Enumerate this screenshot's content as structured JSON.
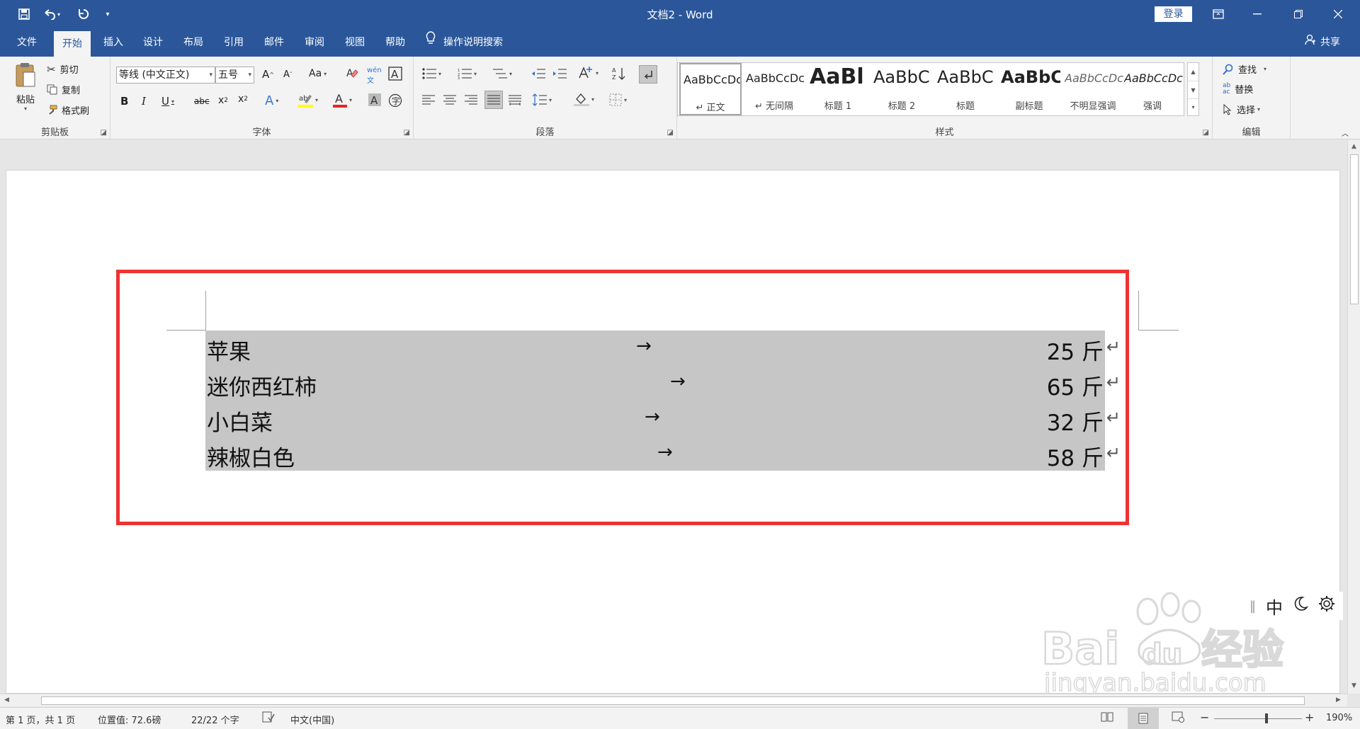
{
  "title_bar": {
    "title": "文档2  -  Word",
    "login_label": "登录",
    "quick_access": [
      "save-icon",
      "undo-icon",
      "redo-icon",
      "customize-icon"
    ]
  },
  "tabs": [
    {
      "label": "文件"
    },
    {
      "label": "开始"
    },
    {
      "label": "插入"
    },
    {
      "label": "设计"
    },
    {
      "label": "布局"
    },
    {
      "label": "引用"
    },
    {
      "label": "邮件"
    },
    {
      "label": "审阅"
    },
    {
      "label": "视图"
    },
    {
      "label": "帮助"
    }
  ],
  "tell_me": "操作说明搜索",
  "share": "共享",
  "ribbon": {
    "clipboard": {
      "label": "剪贴板",
      "paste": "粘贴",
      "cut": "剪切",
      "copy": "复制",
      "format_painter": "格式刷"
    },
    "font": {
      "label": "字体",
      "font_name": "等线 (中文正文)",
      "font_size": "五号",
      "change_case": "Aa"
    },
    "paragraph": {
      "label": "段落"
    },
    "styles": {
      "label": "样式",
      "items": [
        {
          "preview": "AaBbCcDc",
          "name": "↵ 正文"
        },
        {
          "preview": "AaBbCcDc",
          "name": "↵ 无间隔"
        },
        {
          "preview": "AaBl",
          "name": "标题 1"
        },
        {
          "preview": "AaBbC",
          "name": "标题 2"
        },
        {
          "preview": "AaBbC",
          "name": "标题"
        },
        {
          "preview": "AaBbC",
          "name": "副标题"
        },
        {
          "preview": "AaBbCcDc",
          "name": "不明显强调"
        },
        {
          "preview": "AaBbCcDc",
          "name": "强调"
        }
      ]
    },
    "editing": {
      "label": "编辑",
      "find": "查找",
      "replace": "替换",
      "select": "选择"
    }
  },
  "document": {
    "rows": [
      {
        "item": "苹果",
        "qty": "25 斤"
      },
      {
        "item": "迷你西红柿",
        "qty": "65 斤"
      },
      {
        "item": "小白菜",
        "qty": "32 斤"
      },
      {
        "item": "辣椒白色",
        "qty": "58 斤"
      }
    ],
    "tab_arrow": "→",
    "paragraph_mark": "↵"
  },
  "ime": {
    "mode": "中"
  },
  "watermark": {
    "brand": "Bai du 经验",
    "url": "jingyan.baidu.com"
  },
  "status_bar": {
    "page": "第 1 页，共 1 页",
    "position": "位置值: 72.6磅",
    "word_count": "22/22 个字",
    "language": "中文(中国)",
    "zoom": "190%"
  },
  "colors": {
    "ribbon_blue": "#2b579a",
    "highlight_box": "#ee3333",
    "selection": "#c6c6c6"
  }
}
